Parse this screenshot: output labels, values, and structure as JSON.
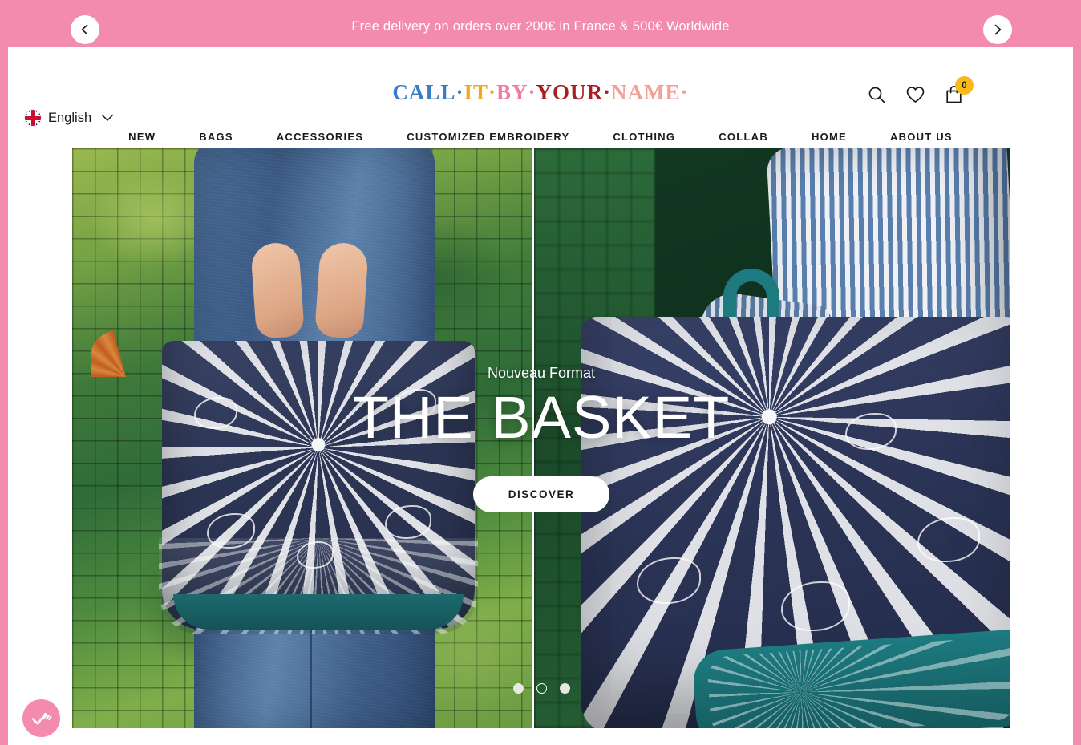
{
  "announcement": {
    "text": "Free delivery on orders over 200€ in France & 500€ Worldwide",
    "prev_label": "Previous announcement",
    "next_label": "Next announcement",
    "background": "#F28BAE"
  },
  "header": {
    "logo_parts": [
      {
        "text": "CALL",
        "color": "#3B7CC4"
      },
      {
        "text": "·",
        "color": "#3B7CC4"
      },
      {
        "text": "IT",
        "color": "#F0A81E"
      },
      {
        "text": "·",
        "color": "#F0A81E"
      },
      {
        "text": "BY",
        "color": "#F07BA8"
      },
      {
        "text": "·",
        "color": "#F07BA8"
      },
      {
        "text": "YOUR",
        "color": "#A81D22"
      },
      {
        "text": "·",
        "color": "#A81D22"
      },
      {
        "text": "NAME",
        "color": "#F3A196"
      },
      {
        "text": "·",
        "color": "#F3A196"
      }
    ],
    "language": {
      "label": "English",
      "flag": "uk-flag-icon"
    },
    "icons": {
      "search": "search-icon",
      "wishlist": "heart-icon",
      "cart": "shopping-bag-icon"
    },
    "cart_count": "0",
    "cart_badge_color": "#F9B91B"
  },
  "nav": {
    "items": [
      {
        "label": "NEW"
      },
      {
        "label": "BAGS"
      },
      {
        "label": "ACCESSORIES"
      },
      {
        "label": "CUSTOMIZED EMBROIDERY"
      },
      {
        "label": "CLOTHING"
      },
      {
        "label": "COLLAB"
      },
      {
        "label": "HOME"
      },
      {
        "label": "ABOUT US"
      }
    ]
  },
  "hero": {
    "subtitle": "Nouveau Format",
    "title": "THE BASKET",
    "cta_label": "DISCOVER",
    "slides": [
      {
        "label": "slide-1",
        "active": false
      },
      {
        "label": "slide-2",
        "active": true
      },
      {
        "label": "slide-3",
        "active": false
      }
    ]
  },
  "widget": {
    "name": "accessibility-widget",
    "icon": "check-swoosh-icon",
    "color": "#F28BAE"
  }
}
